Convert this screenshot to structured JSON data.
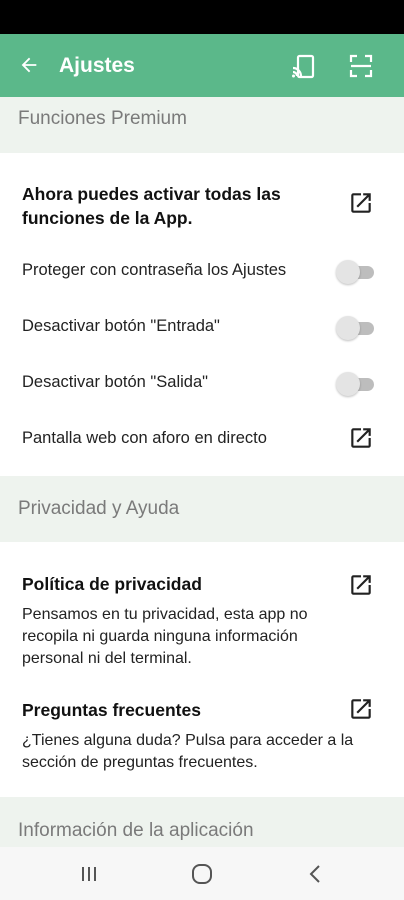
{
  "app_bar": {
    "title": "Ajustes",
    "back_icon": "arrow-left-icon",
    "actions": [
      "cast-icon",
      "qr-scan-icon"
    ],
    "color": "#5bb88a"
  },
  "sections": {
    "premium": {
      "header": "Funciones Premium",
      "activate_label": "Ahora puedes activar todas las funciones de la App.",
      "settings": [
        {
          "label": "Proteger con contraseña los Ajustes",
          "enabled": false
        },
        {
          "label": "Desactivar botón \"Entrada\"",
          "enabled": false
        },
        {
          "label": "Desactivar botón \"Salida\"",
          "enabled": false
        }
      ],
      "web_screen_label": "Pantalla web con aforo en directo"
    },
    "privacy": {
      "header": "Privacidad y Ayuda",
      "policy_title": "Política de privacidad",
      "policy_desc": "Pensamos en tu privacidad, esta app no recopila ni guarda ninguna información personal ni del terminal.",
      "faq_title": "Preguntas frecuentes",
      "faq_desc": "¿Tienes alguna duda? Pulsa para acceder a la sección de preguntas frecuentes."
    },
    "app_info": {
      "header": "Información de la aplicación"
    }
  },
  "nav_bar": {
    "buttons": [
      "recents-icon",
      "home-icon",
      "back-icon"
    ]
  }
}
